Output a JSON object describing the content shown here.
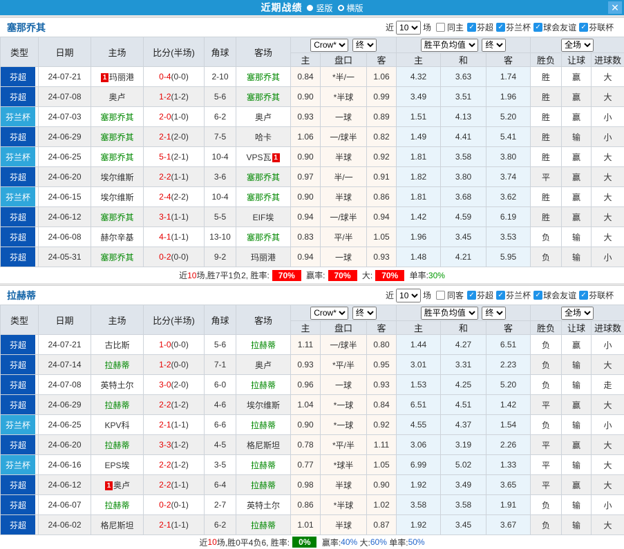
{
  "titlebar": {
    "title": "近期战绩",
    "vertical": "竖版",
    "horizontal": "横版",
    "close": "✕"
  },
  "labels": {
    "near": "近",
    "count": "10",
    "matches": "场"
  },
  "columns": {
    "left": [
      "类型",
      "日期",
      "主场",
      "比分(半场)",
      "角球",
      "客场"
    ],
    "asia": {
      "bookmaker": "Crow*",
      "time": "终",
      "sub": [
        "主",
        "盘口",
        "客"
      ]
    },
    "europe": {
      "kind": "胜平负均值",
      "time": "终",
      "sub": [
        "主",
        "和",
        "客"
      ]
    },
    "result": {
      "scope": "全场",
      "sub": [
        "胜负",
        "让球",
        "进球数"
      ]
    }
  },
  "colors": {
    "accent": "#2095D3",
    "type_dark": "#0A55B5",
    "type_cyan": "#2FA7DB",
    "red": "#E60000",
    "green": "#008800",
    "blue": "#2233CC"
  },
  "sections": [
    {
      "team": "塞那乔其",
      "same_label": "同主",
      "leagues": [
        "芬超",
        "芬兰杯",
        "球会友谊",
        "芬联杯"
      ],
      "rows": [
        {
          "type": "芬超",
          "tcolor": "dark",
          "date": "24-07-21",
          "home": "玛丽港",
          "home_badge": "1",
          "home_badge_pos": "before",
          "home_green": false,
          "score": "0-4",
          "half": "(0-0)",
          "corners": "2-10",
          "away": "塞那乔其",
          "away_green": true,
          "asia_home": "0.84",
          "handicap": "*半/一",
          "handicap_red": true,
          "asia_away": "1.06",
          "euro_home": "4.32",
          "euro_draw": "3.63",
          "euro_away": "1.74",
          "wdl": "胜",
          "wdl_color": "red",
          "spread": "赢",
          "spread_color": "red",
          "goals": "大",
          "goals_color": "red"
        },
        {
          "type": "芬超",
          "tcolor": "dark",
          "date": "24-07-08",
          "home": "奥卢",
          "home_green": false,
          "score": "1-2",
          "half": "(1-2)",
          "corners": "5-6",
          "away": "塞那乔其",
          "away_green": true,
          "asia_home": "0.90",
          "handicap": "*半球",
          "handicap_red": true,
          "asia_away": "0.99",
          "euro_home": "3.49",
          "euro_draw": "3.51",
          "euro_away": "1.96",
          "wdl": "胜",
          "wdl_color": "red",
          "spread": "赢",
          "spread_color": "red",
          "goals": "大",
          "goals_color": "red"
        },
        {
          "type": "芬兰杯",
          "tcolor": "cyan",
          "date": "24-07-03",
          "home": "塞那乔其",
          "home_green": true,
          "score": "2-0",
          "half": "(1-0)",
          "corners": "6-2",
          "away": "奥卢",
          "away_green": false,
          "asia_home": "0.93",
          "handicap": "一球",
          "handicap_red": false,
          "asia_away": "0.89",
          "euro_home": "1.51",
          "euro_draw": "4.13",
          "euro_away": "5.20",
          "wdl": "胜",
          "wdl_color": "red",
          "spread": "赢",
          "spread_color": "red",
          "goals": "小",
          "goals_color": "green"
        },
        {
          "type": "芬超",
          "tcolor": "dark",
          "date": "24-06-29",
          "home": "塞那乔其",
          "home_green": true,
          "score": "2-1",
          "half": "(2-0)",
          "corners": "7-5",
          "away": "哈卡",
          "away_green": false,
          "asia_home": "1.06",
          "handicap": "一/球半",
          "handicap_red": false,
          "asia_away": "0.82",
          "euro_home": "1.49",
          "euro_draw": "4.41",
          "euro_away": "5.41",
          "wdl": "胜",
          "wdl_color": "red",
          "spread": "输",
          "spread_color": "green",
          "goals": "小",
          "goals_color": "green"
        },
        {
          "type": "芬兰杯",
          "tcolor": "cyan",
          "date": "24-06-25",
          "home": "塞那乔其",
          "home_green": true,
          "score": "5-1",
          "half": "(2-1)",
          "corners": "10-4",
          "away": "VPS瓦",
          "away_badge": "1",
          "away_badge_pos": "after",
          "away_green": false,
          "asia_home": "0.90",
          "handicap": "半球",
          "handicap_red": false,
          "asia_away": "0.92",
          "euro_home": "1.81",
          "euro_draw": "3.58",
          "euro_away": "3.80",
          "wdl": "胜",
          "wdl_color": "red",
          "spread": "赢",
          "spread_color": "red",
          "goals": "大",
          "goals_color": "red"
        },
        {
          "type": "芬超",
          "tcolor": "dark",
          "date": "24-06-20",
          "home": "埃尔维斯",
          "home_green": false,
          "score": "2-2",
          "half": "(1-1)",
          "corners": "3-6",
          "away": "塞那乔其",
          "away_green": true,
          "asia_home": "0.97",
          "handicap": "半/一",
          "handicap_red": false,
          "asia_away": "0.91",
          "euro_home": "1.82",
          "euro_draw": "3.80",
          "euro_away": "3.74",
          "wdl": "平",
          "wdl_color": "blue",
          "spread": "赢",
          "spread_color": "red",
          "goals": "大",
          "goals_color": "red"
        },
        {
          "type": "芬兰杯",
          "tcolor": "cyan",
          "date": "24-06-15",
          "home": "埃尔维斯",
          "home_green": false,
          "score": "2-4",
          "half": "(2-2)",
          "corners": "10-4",
          "away": "塞那乔其",
          "away_green": true,
          "asia_home": "0.90",
          "handicap": "半球",
          "handicap_red": false,
          "asia_away": "0.86",
          "euro_home": "1.81",
          "euro_draw": "3.68",
          "euro_away": "3.62",
          "wdl": "胜",
          "wdl_color": "red",
          "spread": "赢",
          "spread_color": "red",
          "goals": "大",
          "goals_color": "red"
        },
        {
          "type": "芬超",
          "tcolor": "dark",
          "date": "24-06-12",
          "home": "塞那乔其",
          "home_green": true,
          "score": "3-1",
          "half": "(1-1)",
          "corners": "5-5",
          "away": "EIF埃",
          "away_green": false,
          "asia_home": "0.94",
          "handicap": "一/球半",
          "handicap_red": false,
          "asia_away": "0.94",
          "euro_home": "1.42",
          "euro_draw": "4.59",
          "euro_away": "6.19",
          "wdl": "胜",
          "wdl_color": "red",
          "spread": "赢",
          "spread_color": "red",
          "goals": "大",
          "goals_color": "red"
        },
        {
          "type": "芬超",
          "tcolor": "dark",
          "date": "24-06-08",
          "home": "赫尔辛基",
          "home_green": false,
          "score": "4-1",
          "half": "(1-1)",
          "corners": "13-10",
          "away": "塞那乔其",
          "away_green": true,
          "asia_home": "0.83",
          "handicap": "平/半",
          "handicap_red": false,
          "asia_away": "1.05",
          "euro_home": "1.96",
          "euro_draw": "3.45",
          "euro_away": "3.53",
          "wdl": "负",
          "wdl_color": "green",
          "spread": "输",
          "spread_color": "green",
          "goals": "大",
          "goals_color": "red"
        },
        {
          "type": "芬超",
          "tcolor": "dark",
          "date": "24-05-31",
          "home": "塞那乔其",
          "home_green": true,
          "score": "0-2",
          "half": "(0-0)",
          "corners": "9-2",
          "away": "玛丽港",
          "away_green": false,
          "asia_home": "0.94",
          "handicap": "一球",
          "handicap_red": false,
          "asia_away": "0.93",
          "euro_home": "1.48",
          "euro_draw": "4.21",
          "euro_away": "5.95",
          "wdl": "负",
          "wdl_color": "green",
          "spread": "输",
          "spread_color": "green",
          "goals": "小",
          "goals_color": "green"
        }
      ],
      "summary": [
        {
          "t": "近",
          "s": "k"
        },
        {
          "t": "10",
          "s": "r"
        },
        {
          "t": "场,胜7平1负2, 胜率:",
          "s": "k"
        },
        {
          "t": "70%",
          "s": "rb"
        },
        {
          "t": " 赢率:",
          "s": "k"
        },
        {
          "t": "70%",
          "s": "rb"
        },
        {
          "t": " 大:",
          "s": "k"
        },
        {
          "t": "70%",
          "s": "rb"
        },
        {
          "t": " 单率:",
          "s": "k"
        },
        {
          "t": "30%",
          "s": "g"
        }
      ]
    },
    {
      "team": "拉赫蒂",
      "same_label": "同客",
      "leagues": [
        "芬超",
        "芬兰杯",
        "球会友谊",
        "芬联杯"
      ],
      "rows": [
        {
          "type": "芬超",
          "tcolor": "dark",
          "date": "24-07-21",
          "home": "古比斯",
          "home_green": false,
          "score": "1-0",
          "half": "(0-0)",
          "corners": "5-6",
          "away": "拉赫蒂",
          "away_green": true,
          "asia_home": "1.11",
          "handicap": "一/球半",
          "handicap_red": false,
          "asia_away": "0.80",
          "euro_home": "1.44",
          "euro_draw": "4.27",
          "euro_away": "6.51",
          "wdl": "负",
          "wdl_color": "green",
          "spread": "赢",
          "spread_color": "red",
          "goals": "小",
          "goals_color": "green"
        },
        {
          "type": "芬超",
          "tcolor": "dark",
          "date": "24-07-14",
          "home": "拉赫蒂",
          "home_green": true,
          "score": "1-2",
          "half": "(0-0)",
          "corners": "7-1",
          "away": "奥卢",
          "away_green": false,
          "asia_home": "0.93",
          "handicap": "*平/半",
          "handicap_red": true,
          "asia_away": "0.95",
          "euro_home": "3.01",
          "euro_draw": "3.31",
          "euro_away": "2.23",
          "wdl": "负",
          "wdl_color": "green",
          "spread": "输",
          "spread_color": "green",
          "goals": "大",
          "goals_color": "red"
        },
        {
          "type": "芬超",
          "tcolor": "dark",
          "date": "24-07-08",
          "home": "英特土尔",
          "home_green": false,
          "score": "3-0",
          "half": "(2-0)",
          "corners": "6-0",
          "away": "拉赫蒂",
          "away_green": true,
          "asia_home": "0.96",
          "handicap": "一球",
          "handicap_red": false,
          "asia_away": "0.93",
          "euro_home": "1.53",
          "euro_draw": "4.25",
          "euro_away": "5.20",
          "wdl": "负",
          "wdl_color": "green",
          "spread": "输",
          "spread_color": "green",
          "goals": "走",
          "goals_color": "blue"
        },
        {
          "type": "芬超",
          "tcolor": "dark",
          "date": "24-06-29",
          "home": "拉赫蒂",
          "home_green": true,
          "score": "2-2",
          "half": "(1-2)",
          "corners": "4-6",
          "away": "埃尔维斯",
          "away_green": false,
          "asia_home": "1.04",
          "handicap": "*一球",
          "handicap_red": true,
          "asia_away": "0.84",
          "euro_home": "6.51",
          "euro_draw": "4.51",
          "euro_away": "1.42",
          "wdl": "平",
          "wdl_color": "blue",
          "spread": "赢",
          "spread_color": "red",
          "goals": "大",
          "goals_color": "red"
        },
        {
          "type": "芬兰杯",
          "tcolor": "cyan",
          "date": "24-06-25",
          "home": "KPV科",
          "home_green": false,
          "score": "2-1",
          "half": "(1-1)",
          "corners": "6-6",
          "away": "拉赫蒂",
          "away_green": true,
          "asia_home": "0.90",
          "handicap": "*一球",
          "handicap_red": true,
          "asia_away": "0.92",
          "euro_home": "4.55",
          "euro_draw": "4.37",
          "euro_away": "1.54",
          "wdl": "负",
          "wdl_color": "green",
          "spread": "输",
          "spread_color": "green",
          "goals": "小",
          "goals_color": "green"
        },
        {
          "type": "芬超",
          "tcolor": "dark",
          "date": "24-06-20",
          "home": "拉赫蒂",
          "home_green": true,
          "score": "3-3",
          "half": "(1-2)",
          "corners": "4-5",
          "away": "格尼斯坦",
          "away_green": false,
          "asia_home": "0.78",
          "handicap": "*平/半",
          "handicap_red": true,
          "asia_away": "1.11",
          "euro_home": "3.06",
          "euro_draw": "3.19",
          "euro_away": "2.26",
          "wdl": "平",
          "wdl_color": "blue",
          "spread": "赢",
          "spread_color": "red",
          "goals": "大",
          "goals_color": "red"
        },
        {
          "type": "芬兰杯",
          "tcolor": "cyan",
          "date": "24-06-16",
          "home": "EPS埃",
          "home_green": false,
          "score": "2-2",
          "half": "(1-2)",
          "corners": "3-5",
          "away": "拉赫蒂",
          "away_green": true,
          "asia_home": "0.77",
          "handicap": "*球半",
          "handicap_red": true,
          "asia_away": "1.05",
          "euro_home": "6.99",
          "euro_draw": "5.02",
          "euro_away": "1.33",
          "wdl": "平",
          "wdl_color": "blue",
          "spread": "输",
          "spread_color": "green",
          "goals": "大",
          "goals_color": "red"
        },
        {
          "type": "芬超",
          "tcolor": "dark",
          "date": "24-06-12",
          "home": "奥卢",
          "home_badge": "1",
          "home_badge_pos": "before",
          "home_green": false,
          "score": "2-2",
          "half": "(1-1)",
          "corners": "6-4",
          "away": "拉赫蒂",
          "away_green": true,
          "asia_home": "0.98",
          "handicap": "半球",
          "handicap_red": false,
          "asia_away": "0.90",
          "euro_home": "1.92",
          "euro_draw": "3.49",
          "euro_away": "3.65",
          "wdl": "平",
          "wdl_color": "blue",
          "spread": "赢",
          "spread_color": "red",
          "goals": "大",
          "goals_color": "red"
        },
        {
          "type": "芬超",
          "tcolor": "dark",
          "date": "24-06-07",
          "home": "拉赫蒂",
          "home_green": true,
          "score": "0-2",
          "half": "(0-1)",
          "corners": "2-7",
          "away": "英特土尔",
          "away_green": false,
          "asia_home": "0.86",
          "handicap": "*半球",
          "handicap_red": true,
          "asia_away": "1.02",
          "euro_home": "3.58",
          "euro_draw": "3.58",
          "euro_away": "1.91",
          "wdl": "负",
          "wdl_color": "green",
          "spread": "输",
          "spread_color": "green",
          "goals": "小",
          "goals_color": "green"
        },
        {
          "type": "芬超",
          "tcolor": "dark",
          "date": "24-06-02",
          "home": "格尼斯坦",
          "home_green": false,
          "score": "2-1",
          "half": "(1-1)",
          "corners": "6-2",
          "away": "拉赫蒂",
          "away_green": true,
          "asia_home": "1.01",
          "handicap": "半球",
          "handicap_red": false,
          "asia_away": "0.87",
          "euro_home": "1.92",
          "euro_draw": "3.45",
          "euro_away": "3.67",
          "wdl": "负",
          "wdl_color": "green",
          "spread": "输",
          "spread_color": "green",
          "goals": "大",
          "goals_color": "red"
        }
      ],
      "summary": [
        {
          "t": "近",
          "s": "k"
        },
        {
          "t": "10",
          "s": "r"
        },
        {
          "t": "场,胜0平4负6, 胜率:",
          "s": "k"
        },
        {
          "t": "0%",
          "s": "gb"
        },
        {
          "t": " 赢率:",
          "s": "k"
        },
        {
          "t": "40%",
          "s": "b"
        },
        {
          "t": " 大:",
          "s": "k"
        },
        {
          "t": "60%",
          "s": "b"
        },
        {
          "t": " 单率:",
          "s": "k"
        },
        {
          "t": "50%",
          "s": "b"
        }
      ]
    }
  ]
}
